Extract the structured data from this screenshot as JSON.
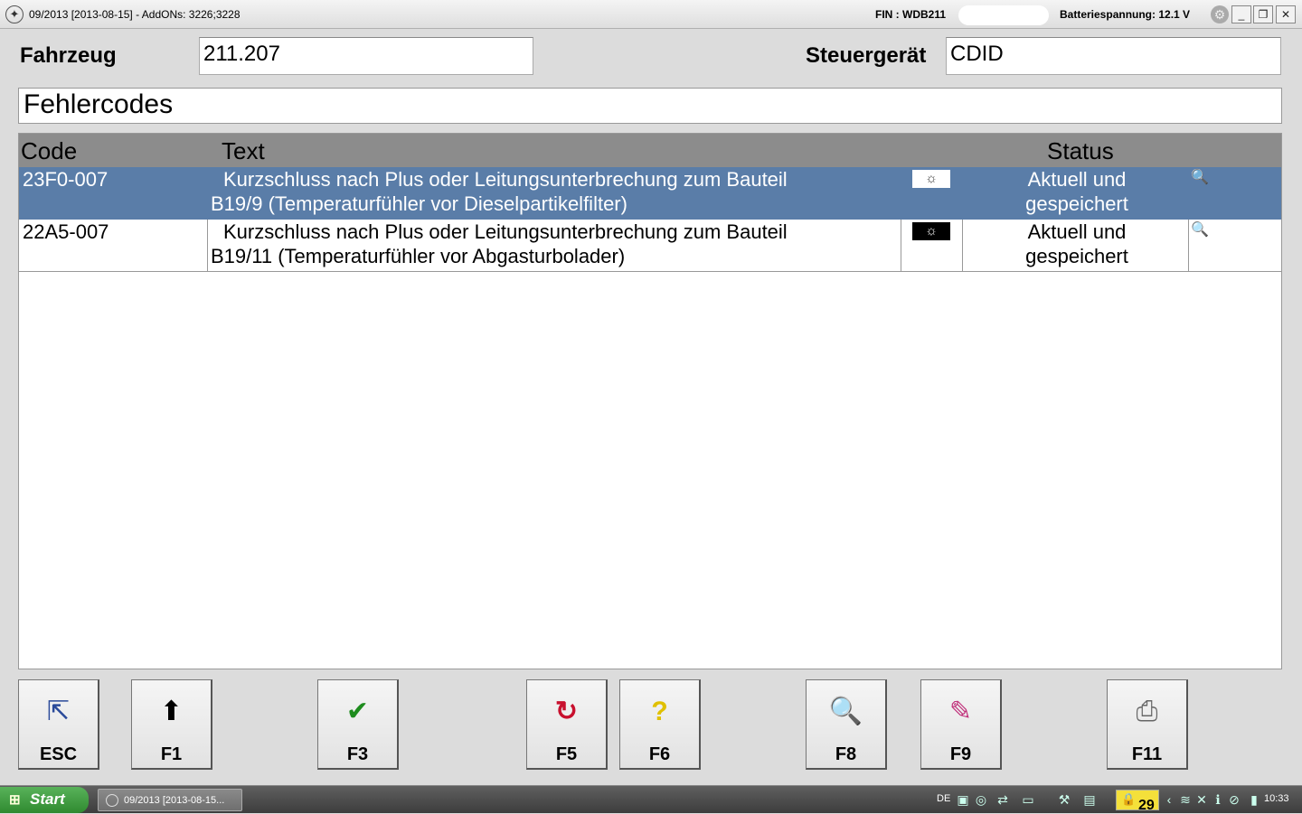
{
  "window": {
    "title": "09/2013 [2013-08-15] - AddONs: 3226;3228",
    "fin": "FIN : WDB211",
    "battery": "Batteriespannung: 12.1 V",
    "min_label": "_",
    "restore_label": "❐",
    "close_label": "✕"
  },
  "form": {
    "vehicle_label": "Fahrzeug",
    "vehicle_value": "211.207",
    "ecu_label": "Steuergerät",
    "ecu_value": "CDID"
  },
  "section_title": "Fehlercodes",
  "table": {
    "headers": {
      "code": "Code",
      "text": "Text",
      "status": "Status"
    },
    "rows": [
      {
        "code": "23F0-007",
        "text_line1": "Kurzschluss nach Plus oder Leitungsunterbrechung zum Bauteil",
        "text_line2": "B19/9 (Temperaturfühler vor Dieselpartikelfilter)",
        "lamp_icon": "☼",
        "status_line1": "Aktuell und",
        "status_line2": "gespeichert",
        "detail_icon": "🔍",
        "selected": true
      },
      {
        "code": "22A5-007",
        "text_line1": "Kurzschluss nach Plus oder Leitungsunterbrechung zum Bauteil",
        "text_line2": "B19/11 (Temperaturfühler vor Abgasturbolader)",
        "lamp_icon": "☼",
        "status_line1": "Aktuell und",
        "status_line2": "gespeichert",
        "detail_icon": "🔍",
        "selected": false
      }
    ]
  },
  "function_keys": [
    {
      "label": "ESC",
      "icon": "exit-door-icon",
      "glyph": "⇱"
    },
    {
      "label": "F1",
      "icon": "arrow-up-icon",
      "glyph": "⬆"
    },
    {
      "label": "F3",
      "icon": "checkmark-icon",
      "glyph": "✔"
    },
    {
      "label": "F5",
      "icon": "refresh-icon",
      "glyph": "↻"
    },
    {
      "label": "F6",
      "icon": "help-icon",
      "glyph": "?"
    },
    {
      "label": "F8",
      "icon": "magnifier-icon",
      "glyph": "🔍"
    },
    {
      "label": "F9",
      "icon": "report-icon",
      "glyph": "✎"
    },
    {
      "label": "F11",
      "icon": "printer-icon",
      "glyph": "⎙"
    }
  ],
  "taskbar": {
    "start_label": "Start",
    "task_label": "09/2013 [2013-08-15...",
    "lang": "DE",
    "badge_count": "29",
    "clock": "10:33"
  },
  "colors": {
    "selected_row": "#5a7da8",
    "header_bg": "#8c8c8c",
    "f3_check": "#1e8c1e",
    "f5_refresh": "#c8102e",
    "f6_help": "#e0c000"
  }
}
